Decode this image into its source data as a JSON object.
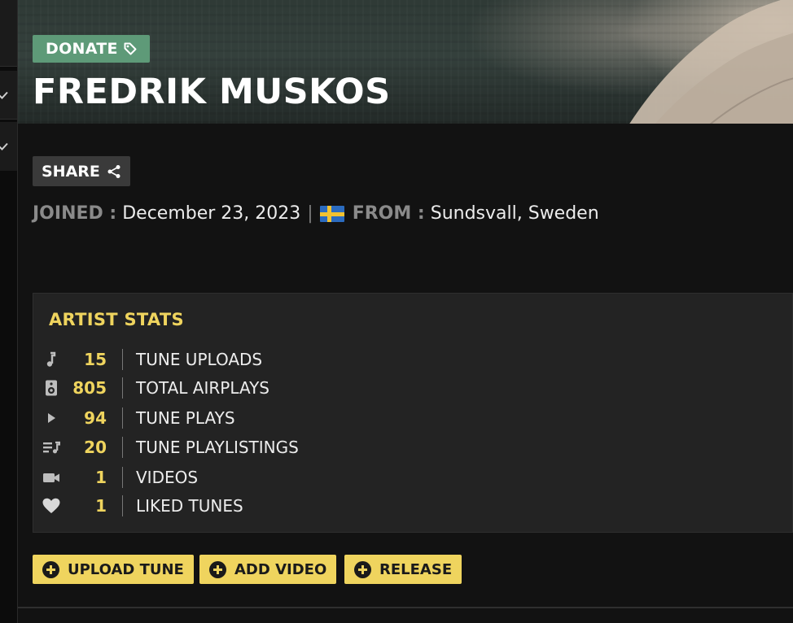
{
  "hero": {
    "donate_label": "DONATE",
    "artist_name": "FREDRIK MUSKOS"
  },
  "profile": {
    "share_label": "SHARE",
    "joined_label": "JOINED :",
    "joined_value": "December 23, 2023",
    "separator": "|",
    "from_label": "FROM :",
    "from_value": "Sundsvall, Sweden",
    "flag_icon": "sweden-flag-icon"
  },
  "stats": {
    "title": "ARTIST STATS",
    "items": [
      {
        "icon": "music-note-icon",
        "value": "15",
        "label": "TUNE UPLOADS"
      },
      {
        "icon": "speaker-icon",
        "value": "805",
        "label": "TOTAL AIRPLAYS"
      },
      {
        "icon": "play-icon",
        "value": "94",
        "label": "TUNE PLAYS"
      },
      {
        "icon": "playlist-icon",
        "value": "20",
        "label": "TUNE PLAYLISTINGS"
      },
      {
        "icon": "video-camera-icon",
        "value": "1",
        "label": "VIDEOS"
      },
      {
        "icon": "heart-icon",
        "value": "1",
        "label": "LIKED TUNES"
      }
    ]
  },
  "actions": {
    "upload_tune_label": "UPLOAD TUNE",
    "add_video_label": "ADD VIDEO",
    "release_label": "RELEASE"
  },
  "colors": {
    "accent_yellow": "#efd45e",
    "donate_green": "#5e9a78",
    "panel_bg": "#232323",
    "page_bg": "#121212"
  }
}
